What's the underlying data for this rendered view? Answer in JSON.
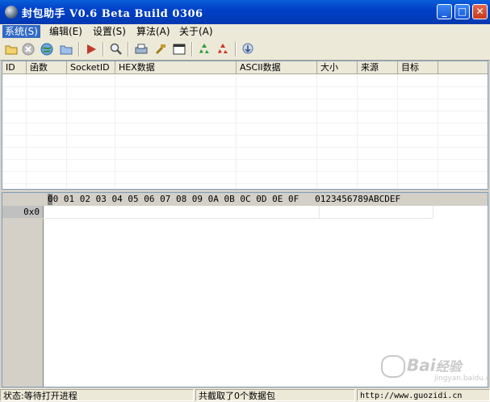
{
  "window": {
    "title": "封包助手 V0.6 Beta Build 0306"
  },
  "menu": {
    "items": [
      {
        "label": "系统(S)"
      },
      {
        "label": "编辑(E)"
      },
      {
        "label": "设置(S)"
      },
      {
        "label": "算法(A)"
      },
      {
        "label": "关于(A)"
      }
    ]
  },
  "toolbar": {
    "icons": [
      "open-icon",
      "stop-icon",
      "globe-icon",
      "folder-icon",
      "play-icon",
      "search-icon",
      "print-icon",
      "tools-icon",
      "window-icon",
      "recycle-green-icon",
      "recycle-red-icon",
      "download-icon"
    ]
  },
  "packet_table": {
    "columns": [
      "ID",
      "函数",
      "SocketID",
      "HEX数据",
      "ASCII数据",
      "大小",
      "来源",
      "目标"
    ]
  },
  "hex_view": {
    "header": "00 01 02 03 04 05 06 07 08 09 0A 0B 0C 0D 0E 0F   0123456789ABCDEF",
    "rows": [
      {
        "address": "0x0"
      }
    ]
  },
  "status": {
    "state": "状态:等待打开进程",
    "captured": "共截取了0个数据包",
    "url": "http://www.guozidi.cn"
  },
  "watermark": {
    "text": "Bai",
    "cn": "经验",
    "sub": "jingyan.baidu.com"
  }
}
